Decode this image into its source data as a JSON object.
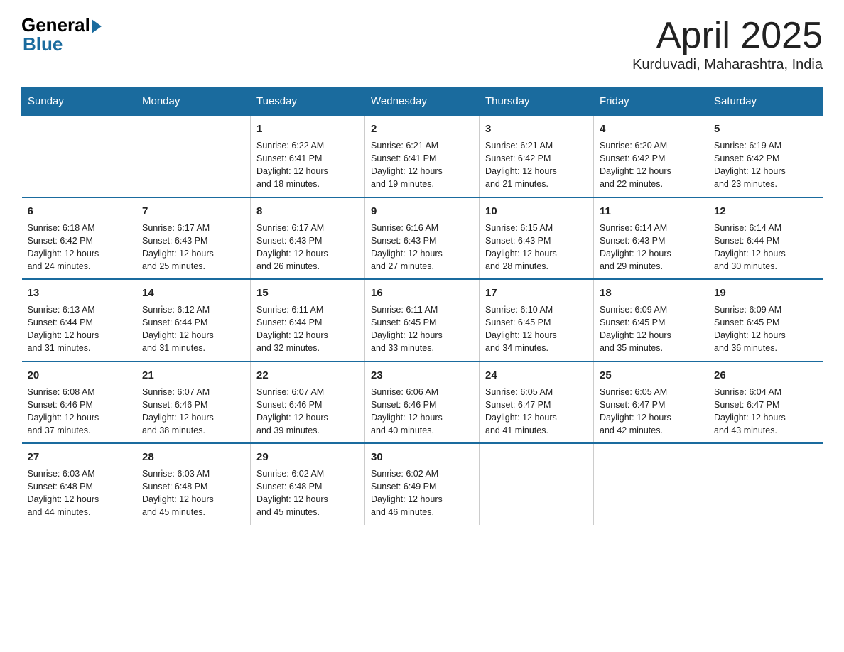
{
  "header": {
    "logo_general": "General",
    "logo_blue": "Blue",
    "title": "April 2025",
    "location": "Kurduvadi, Maharashtra, India"
  },
  "weekdays": [
    "Sunday",
    "Monday",
    "Tuesday",
    "Wednesday",
    "Thursday",
    "Friday",
    "Saturday"
  ],
  "weeks": [
    [
      {
        "day": "",
        "info": ""
      },
      {
        "day": "",
        "info": ""
      },
      {
        "day": "1",
        "info": "Sunrise: 6:22 AM\nSunset: 6:41 PM\nDaylight: 12 hours\nand 18 minutes."
      },
      {
        "day": "2",
        "info": "Sunrise: 6:21 AM\nSunset: 6:41 PM\nDaylight: 12 hours\nand 19 minutes."
      },
      {
        "day": "3",
        "info": "Sunrise: 6:21 AM\nSunset: 6:42 PM\nDaylight: 12 hours\nand 21 minutes."
      },
      {
        "day": "4",
        "info": "Sunrise: 6:20 AM\nSunset: 6:42 PM\nDaylight: 12 hours\nand 22 minutes."
      },
      {
        "day": "5",
        "info": "Sunrise: 6:19 AM\nSunset: 6:42 PM\nDaylight: 12 hours\nand 23 minutes."
      }
    ],
    [
      {
        "day": "6",
        "info": "Sunrise: 6:18 AM\nSunset: 6:42 PM\nDaylight: 12 hours\nand 24 minutes."
      },
      {
        "day": "7",
        "info": "Sunrise: 6:17 AM\nSunset: 6:43 PM\nDaylight: 12 hours\nand 25 minutes."
      },
      {
        "day": "8",
        "info": "Sunrise: 6:17 AM\nSunset: 6:43 PM\nDaylight: 12 hours\nand 26 minutes."
      },
      {
        "day": "9",
        "info": "Sunrise: 6:16 AM\nSunset: 6:43 PM\nDaylight: 12 hours\nand 27 minutes."
      },
      {
        "day": "10",
        "info": "Sunrise: 6:15 AM\nSunset: 6:43 PM\nDaylight: 12 hours\nand 28 minutes."
      },
      {
        "day": "11",
        "info": "Sunrise: 6:14 AM\nSunset: 6:43 PM\nDaylight: 12 hours\nand 29 minutes."
      },
      {
        "day": "12",
        "info": "Sunrise: 6:14 AM\nSunset: 6:44 PM\nDaylight: 12 hours\nand 30 minutes."
      }
    ],
    [
      {
        "day": "13",
        "info": "Sunrise: 6:13 AM\nSunset: 6:44 PM\nDaylight: 12 hours\nand 31 minutes."
      },
      {
        "day": "14",
        "info": "Sunrise: 6:12 AM\nSunset: 6:44 PM\nDaylight: 12 hours\nand 31 minutes."
      },
      {
        "day": "15",
        "info": "Sunrise: 6:11 AM\nSunset: 6:44 PM\nDaylight: 12 hours\nand 32 minutes."
      },
      {
        "day": "16",
        "info": "Sunrise: 6:11 AM\nSunset: 6:45 PM\nDaylight: 12 hours\nand 33 minutes."
      },
      {
        "day": "17",
        "info": "Sunrise: 6:10 AM\nSunset: 6:45 PM\nDaylight: 12 hours\nand 34 minutes."
      },
      {
        "day": "18",
        "info": "Sunrise: 6:09 AM\nSunset: 6:45 PM\nDaylight: 12 hours\nand 35 minutes."
      },
      {
        "day": "19",
        "info": "Sunrise: 6:09 AM\nSunset: 6:45 PM\nDaylight: 12 hours\nand 36 minutes."
      }
    ],
    [
      {
        "day": "20",
        "info": "Sunrise: 6:08 AM\nSunset: 6:46 PM\nDaylight: 12 hours\nand 37 minutes."
      },
      {
        "day": "21",
        "info": "Sunrise: 6:07 AM\nSunset: 6:46 PM\nDaylight: 12 hours\nand 38 minutes."
      },
      {
        "day": "22",
        "info": "Sunrise: 6:07 AM\nSunset: 6:46 PM\nDaylight: 12 hours\nand 39 minutes."
      },
      {
        "day": "23",
        "info": "Sunrise: 6:06 AM\nSunset: 6:46 PM\nDaylight: 12 hours\nand 40 minutes."
      },
      {
        "day": "24",
        "info": "Sunrise: 6:05 AM\nSunset: 6:47 PM\nDaylight: 12 hours\nand 41 minutes."
      },
      {
        "day": "25",
        "info": "Sunrise: 6:05 AM\nSunset: 6:47 PM\nDaylight: 12 hours\nand 42 minutes."
      },
      {
        "day": "26",
        "info": "Sunrise: 6:04 AM\nSunset: 6:47 PM\nDaylight: 12 hours\nand 43 minutes."
      }
    ],
    [
      {
        "day": "27",
        "info": "Sunrise: 6:03 AM\nSunset: 6:48 PM\nDaylight: 12 hours\nand 44 minutes."
      },
      {
        "day": "28",
        "info": "Sunrise: 6:03 AM\nSunset: 6:48 PM\nDaylight: 12 hours\nand 45 minutes."
      },
      {
        "day": "29",
        "info": "Sunrise: 6:02 AM\nSunset: 6:48 PM\nDaylight: 12 hours\nand 45 minutes."
      },
      {
        "day": "30",
        "info": "Sunrise: 6:02 AM\nSunset: 6:49 PM\nDaylight: 12 hours\nand 46 minutes."
      },
      {
        "day": "",
        "info": ""
      },
      {
        "day": "",
        "info": ""
      },
      {
        "day": "",
        "info": ""
      }
    ]
  ]
}
